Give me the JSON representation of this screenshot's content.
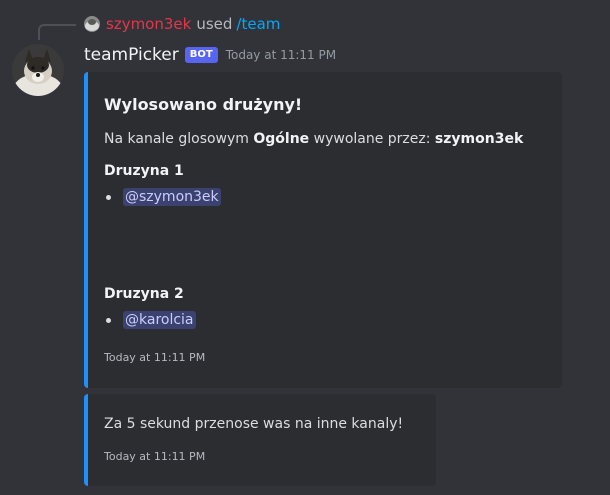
{
  "interaction": {
    "username": "szymon3ek",
    "verb": "used",
    "command": "/team"
  },
  "message": {
    "author": "teamPicker",
    "bot_tag": "BOT",
    "timestamp": "Today at 11:11 PM"
  },
  "embed_main": {
    "title": "Wylosowano drużyny!",
    "description_prefix": "Na kanale glosowym ",
    "channel": "Ogólne",
    "description_mid": " wywolane przez: ",
    "invoker": "szymon3ek",
    "fields": [
      {
        "name": "Druzyna 1",
        "members": [
          "@szymon3ek"
        ]
      },
      {
        "name": "Druzyna 2",
        "members": [
          "@karolcia"
        ]
      }
    ],
    "footer_time": "Today at 11:11 PM"
  },
  "embed_notice": {
    "text": "Za 5 sekund przenose was na inne kanaly!",
    "footer_time": "Today at 11:11 PM"
  },
  "colors": {
    "background": "#313338",
    "embed_bg": "#2b2d31",
    "embed_accent": "#1e90ff",
    "bot_tag": "#5865f2",
    "mention_bg": "#3c4270",
    "interaction_user": "#e8344b",
    "command": "#00a8fc"
  }
}
